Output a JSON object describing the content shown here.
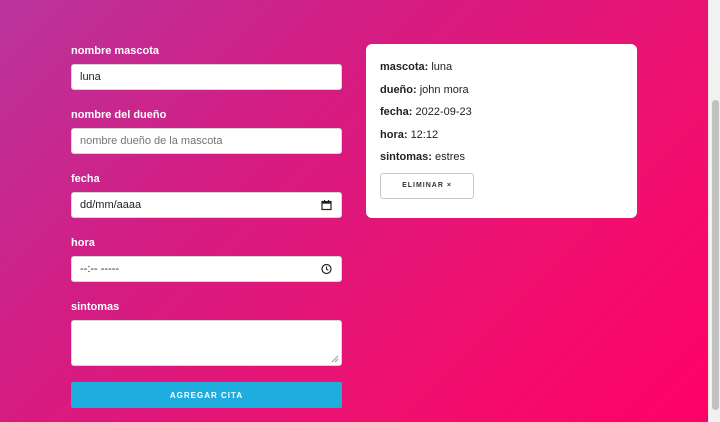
{
  "form": {
    "pet_label": "nombre mascota",
    "pet_value": "luna",
    "owner_label": "nombre del dueño",
    "owner_placeholder": "nombre dueño de la mascota",
    "date_label": "fecha",
    "date_value": "dd/mm/aaaa",
    "time_label": "hora",
    "time_value": "--:-- -----",
    "symptoms_label": "sintomas",
    "symptoms_value": "",
    "submit_label": "AGREGAR CITA"
  },
  "appointment": {
    "pet_key": "mascota:",
    "pet_value": "luna",
    "owner_key": "dueño:",
    "owner_value": "john mora",
    "date_key": "fecha:",
    "date_value": "2022-09-23",
    "time_key": "hora:",
    "time_value": "12:12",
    "symptoms_key": "sintomas:",
    "symptoms_value": "estres",
    "delete_label": "ELIMINAR ×"
  },
  "icons": {
    "date_input_icon": "calendar-icon",
    "time_input_icon": "clock-icon"
  },
  "colors": {
    "submit_button": "#1fade0",
    "background_start": "#b9359d",
    "background_end": "#ff0066"
  }
}
